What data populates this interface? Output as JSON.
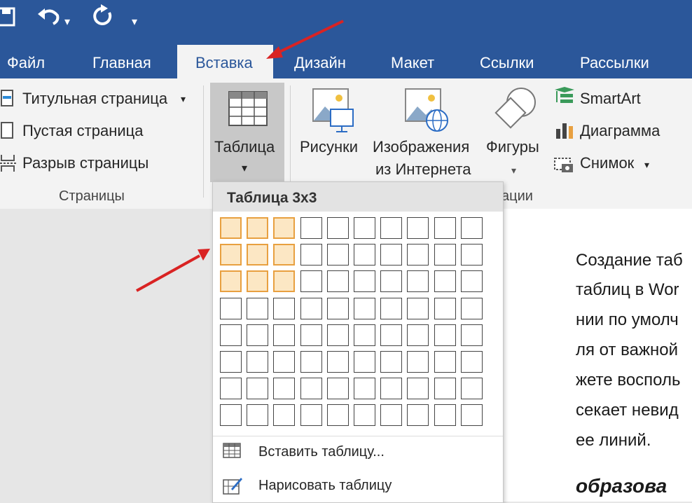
{
  "tabs": [
    "Файл",
    "Главная",
    "Вставка",
    "Дизайн",
    "Макет",
    "Ссылки",
    "Рассылки"
  ],
  "active_tab": "Вставка",
  "pages_group": {
    "items": [
      "Титульная страница",
      "Пустая страница",
      "Разрыв страницы"
    ],
    "label": "Страницы"
  },
  "table_button": {
    "label": "Таблица",
    "arrow": "▾"
  },
  "illustrations": {
    "pictures": "Рисунки",
    "online_pictures_line1": "Изображения",
    "online_pictures_line2": "из Интернета",
    "shapes": "Фигуры",
    "smartart": "SmartArt",
    "chart": "Диаграмма",
    "screenshot": "Снимок",
    "group_label_partial": "ации"
  },
  "dropdown": {
    "title": "Таблица 3x3",
    "grid": {
      "columns": 10,
      "rows": 8,
      "selected_columns": 3,
      "selected_rows": 3
    },
    "insert_table": "Вставить таблицу...",
    "draw_table": "Нарисовать таблицу"
  },
  "document_lines": [
    "Создание таб",
    "таблиц в Wor",
    "нии по умолч",
    "ля от важной",
    "жете восполь",
    "секает невид",
    "ее линий."
  ],
  "document_bold": "образова",
  "colors": {
    "ribbon_blue": "#2b579a",
    "selection_orange": "#e8a040",
    "arrow_red": "#d92323"
  },
  "icons": [
    "save-icon",
    "undo-icon",
    "redo-icon",
    "customize-icon",
    "table-grid-icon",
    "pictures-icon",
    "online-pictures-icon",
    "shapes-icon",
    "smartart-icon",
    "chart-icon",
    "screenshot-icon",
    "insert-table-icon",
    "draw-table-icon"
  ]
}
